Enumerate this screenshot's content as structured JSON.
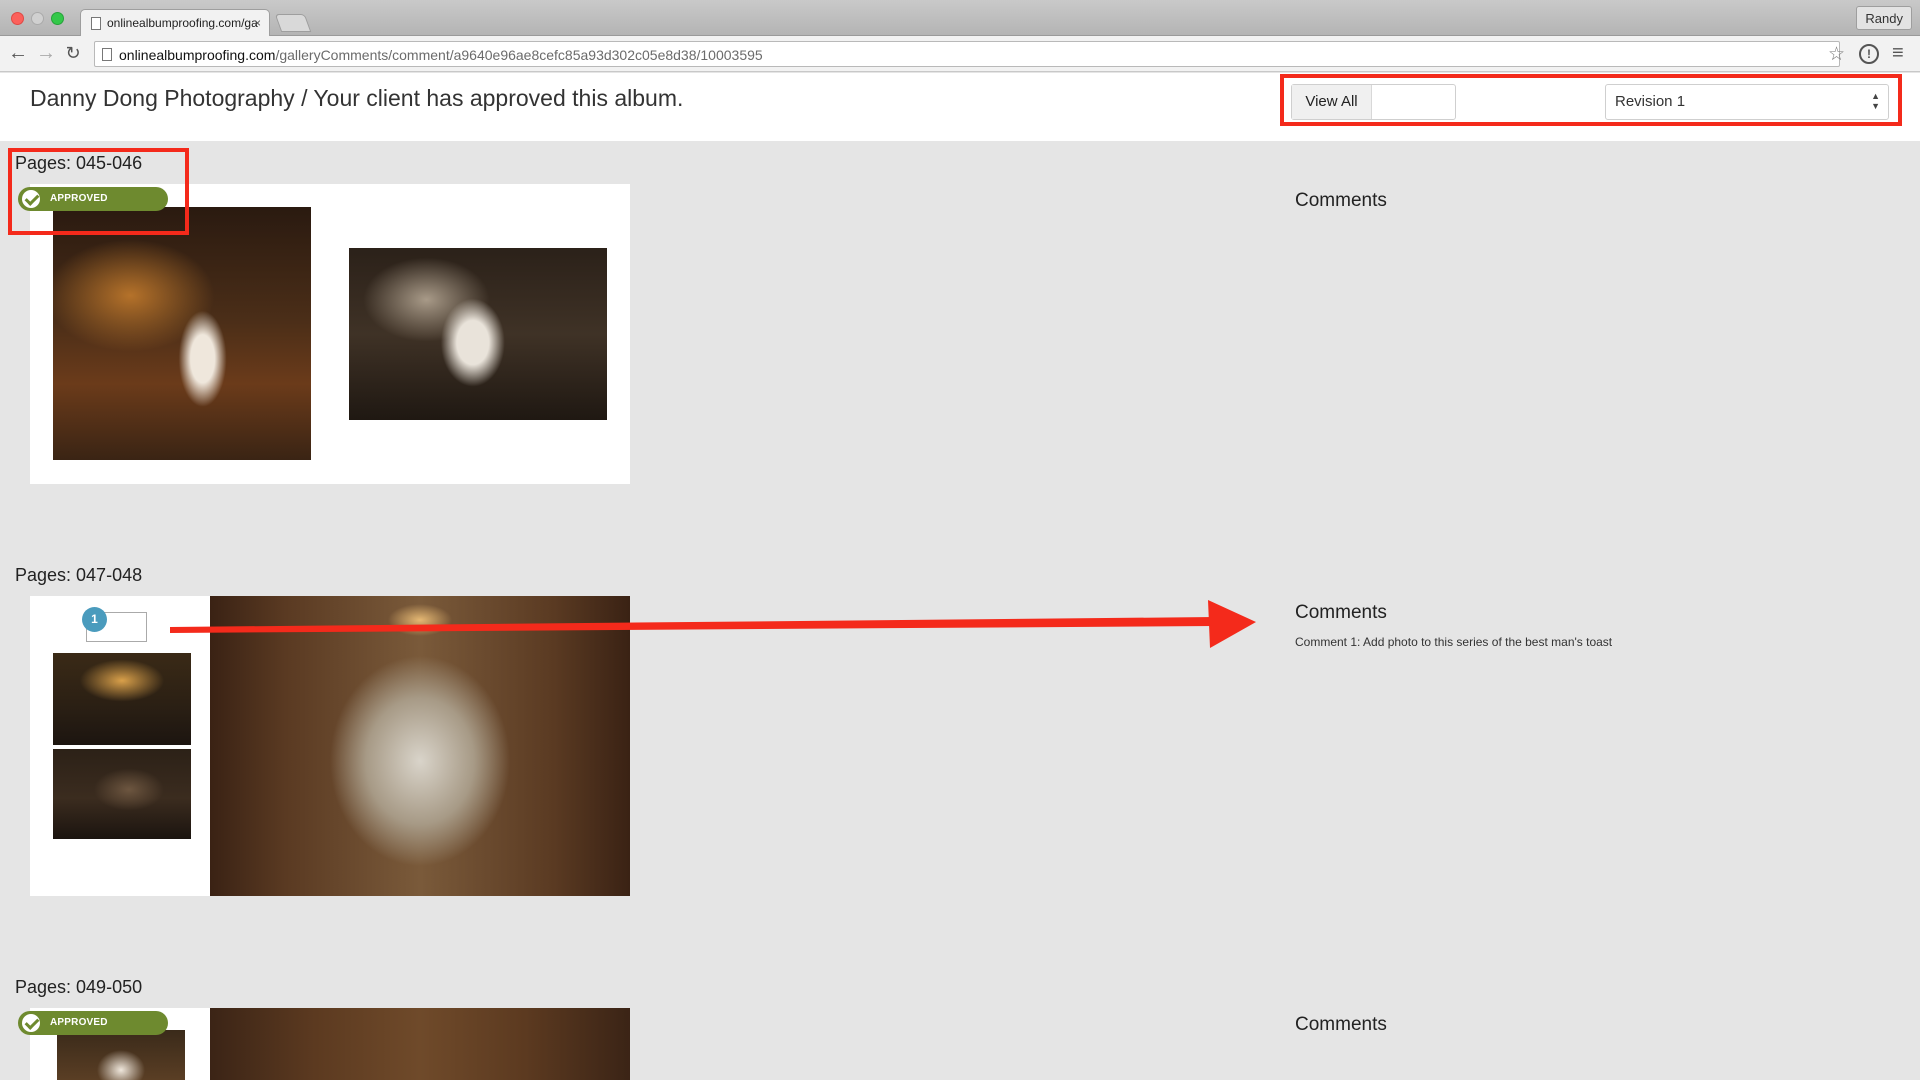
{
  "browser": {
    "tab_title": "onlinealbumproofing.com/ga",
    "tab_close": "×",
    "user_label": "Randy",
    "url_host": "onlinealbumproofing.com",
    "url_path": "/galleryComments/comment/a9640e96ae8cefc85a93d302c05e8d38/10003595",
    "icons": [
      "back-arrow-icon",
      "forward-arrow-icon",
      "reload-icon",
      "page-icon",
      "star-icon",
      "info-icon",
      "hamburger-menu-icon"
    ]
  },
  "header": {
    "title": "Danny Dong Photography / Your client has approved this album.",
    "view_all_label": "View All",
    "revision_selected": "Revision 1"
  },
  "spreads": [
    {
      "label": "Pages: 045-046",
      "status": "APPROVED",
      "comments_heading": "Comments",
      "comments": []
    },
    {
      "label": "Pages: 047-048",
      "status": "",
      "comments_heading": "Comments",
      "marker_number": "1",
      "comments": [
        "Comment 1: Add photo to this series of the best man's toast"
      ]
    },
    {
      "label": "Pages: 049-050",
      "status": "APPROVED",
      "comments_heading": "Comments",
      "comments": []
    }
  ],
  "colors": {
    "annotation_red": "#f42a1b",
    "approved_green": "#6e8a2f",
    "marker_blue": "#4a9bbd",
    "page_bg": "#e5e5e5"
  }
}
